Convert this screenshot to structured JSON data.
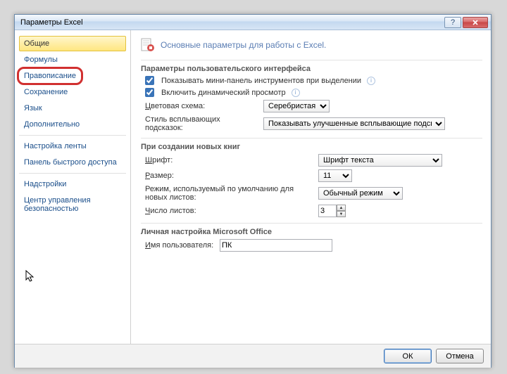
{
  "window": {
    "title": "Параметры Excel"
  },
  "sidebar": {
    "items": [
      "Общие",
      "Формулы",
      "Правописание",
      "Сохранение",
      "Язык",
      "Дополнительно",
      "Настройка ленты",
      "Панель быстрого доступа",
      "Надстройки",
      "Центр управления безопасностью"
    ],
    "active_index": 0,
    "highlighted_index": 2
  },
  "main": {
    "header": "Основные параметры для работы с Excel.",
    "group1": {
      "title": "Параметры пользовательского интерфейса",
      "cb_mini_panel": {
        "label": "Показывать мини-панель инструментов при выделении",
        "checked": true
      },
      "cb_live_preview": {
        "label": "Включить динамический просмотр",
        "checked": true
      },
      "color_scheme": {
        "label": "Цветовая схема:",
        "value": "Серебристая"
      },
      "tooltip_style": {
        "label": "Стиль всплывающих подсказок:",
        "value": "Показывать улучшенные всплывающие подсказки"
      }
    },
    "group2": {
      "title": "При создании новых книг",
      "font": {
        "label": "Шрифт:",
        "value": "Шрифт текста"
      },
      "size": {
        "label": "Размер:",
        "value": "11"
      },
      "default_view": {
        "label": "Режим, используемый по умолчанию для новых листов:",
        "value": "Обычный режим"
      },
      "sheet_count": {
        "label": "Число листов:",
        "value": "3"
      }
    },
    "group3": {
      "title": "Личная настройка Microsoft Office",
      "username": {
        "label": "Имя пользователя:",
        "value": "ПК"
      }
    }
  },
  "footer": {
    "ok": "ОК",
    "cancel": "Отмена"
  }
}
